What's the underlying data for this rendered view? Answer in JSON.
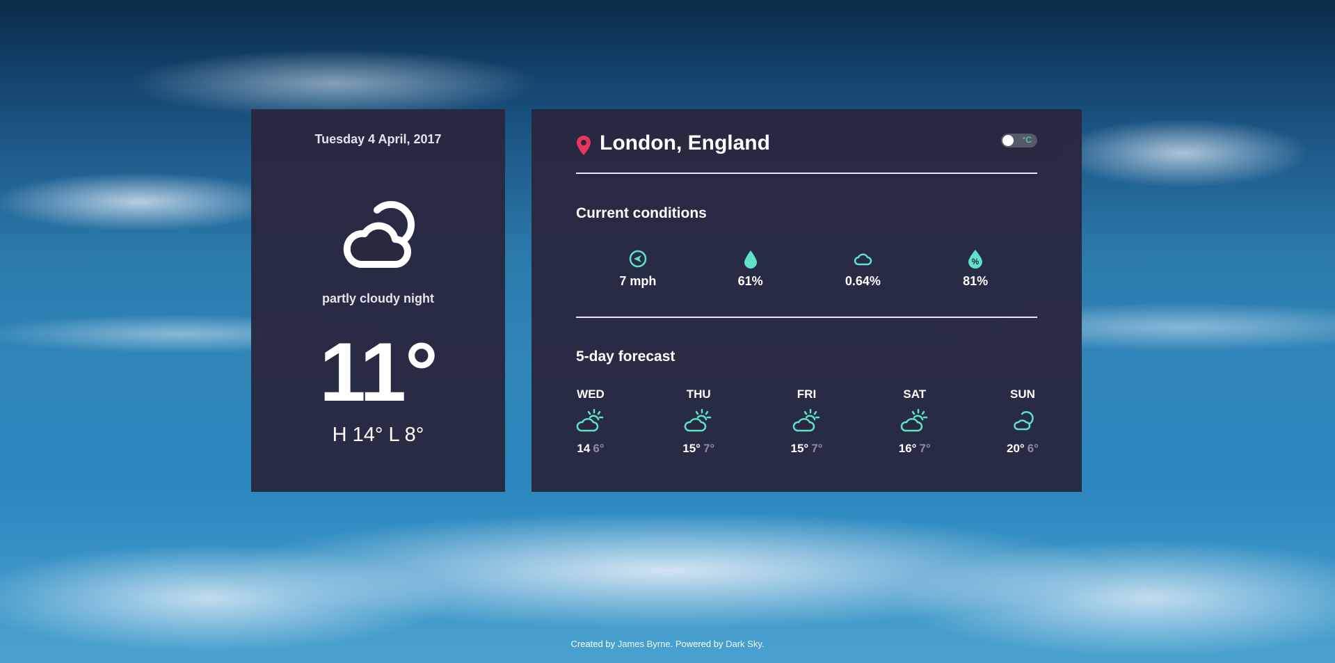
{
  "colors": {
    "accent": "#5ee3c7",
    "pin": "#e8355b",
    "card_bg": "#28283e",
    "low_temp": "#8d8e98"
  },
  "current": {
    "date": "Tuesday 4 April, 2017",
    "icon": "partly-cloudy-night-icon",
    "summary": "partly cloudy night",
    "temperature": "11°",
    "high_low": "H 14° L 8°"
  },
  "location": {
    "name": "London, England",
    "unit_toggle_label": "°C"
  },
  "conditions": {
    "title": "Current conditions",
    "items": [
      {
        "icon": "wind-icon",
        "value": "7 mph"
      },
      {
        "icon": "raindrop-icon",
        "value": "61%"
      },
      {
        "icon": "cloud-icon",
        "value": "0.64%"
      },
      {
        "icon": "humidity-icon",
        "value": "81%"
      }
    ]
  },
  "forecast": {
    "title": "5-day forecast",
    "days": [
      {
        "name": "WED",
        "icon": "partly-cloudy-day-icon",
        "high": "14",
        "low": "6°"
      },
      {
        "name": "THU",
        "icon": "partly-cloudy-day-icon",
        "high": "15°",
        "low": "7°"
      },
      {
        "name": "FRI",
        "icon": "partly-cloudy-day-icon",
        "high": "15°",
        "low": "7°"
      },
      {
        "name": "SAT",
        "icon": "partly-cloudy-day-icon",
        "high": "16°",
        "low": "7°"
      },
      {
        "name": "SUN",
        "icon": "partly-cloudy-night-icon",
        "high": "20°",
        "low": "6°"
      }
    ]
  },
  "footer": {
    "created_prefix": "Created by",
    "author": "James Byrne",
    "powered_prefix": ". Powered by",
    "provider": "Dark Sky",
    "suffix": "."
  }
}
